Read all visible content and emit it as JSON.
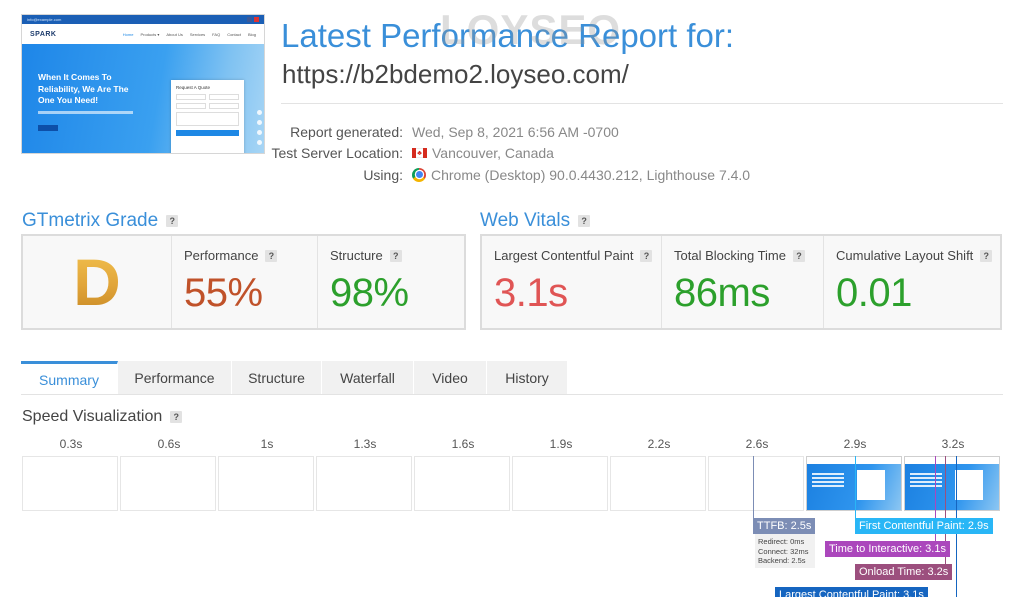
{
  "thumbnail": {
    "email": "info@example.com",
    "logo": "SPARK",
    "menu": [
      "Home",
      "Products ▾",
      "About Us",
      "Services",
      "FAQ",
      "Contact",
      "Blog"
    ],
    "hero_title": "When It Comes To Reliability, We Are The One You Need!",
    "form_title": "Request A Quote"
  },
  "header": {
    "watermark": "LOYSEO",
    "title": "Latest Performance Report for:",
    "url": "https://b2bdemo2.loyseo.com/"
  },
  "meta": {
    "generated_label": "Report generated:",
    "generated_value": "Wed, Sep 8, 2021 6:56 AM -0700",
    "location_label": "Test Server Location:",
    "location_value": "Vancouver, Canada",
    "using_label": "Using:",
    "using_value": "Chrome (Desktop) 90.0.4430.212, Lighthouse 7.4.0",
    "flag_icon": "canada-flag-icon",
    "browser_icon": "chrome-icon"
  },
  "gtmetrix": {
    "title": "GTmetrix Grade",
    "grade": "D",
    "performance_label": "Performance",
    "performance_value": "55%",
    "structure_label": "Structure",
    "structure_value": "98%"
  },
  "web_vitals": {
    "title": "Web Vitals",
    "lcp_label": "Largest Contentful Paint",
    "lcp_value": "3.1s",
    "tbt_label": "Total Blocking Time",
    "tbt_value": "86ms",
    "cls_label": "Cumulative Layout Shift",
    "cls_value": "0.01"
  },
  "help": "?",
  "tabs": [
    "Summary",
    "Performance",
    "Structure",
    "Waterfall",
    "Video",
    "History"
  ],
  "active_tab": "Summary",
  "speed_viz": {
    "title": "Speed Visualization",
    "times": [
      "0.3s",
      "0.6s",
      "1s",
      "1.3s",
      "1.6s",
      "1.9s",
      "2.2s",
      "2.6s",
      "2.9s",
      "3.2s"
    ],
    "markers": {
      "ttfb": "TTFB: 2.5s",
      "fcp": "First Contentful Paint: 2.9s",
      "tti": "Time to Interactive: 3.1s",
      "onload": "Onload Time: 3.2s",
      "lcp": "Largest Contentful Paint: 3.1s"
    },
    "ttfb_details": {
      "redirect": "Redirect: 0ms",
      "connect": "Connect: 32ms",
      "backend": "Backend: 2.5s"
    }
  },
  "colors": {
    "accent": "#3a8fd9",
    "grade_d": "#e0a43a",
    "performance": "#c0522a",
    "good": "#2ca02c",
    "lcp_value": "#e05555",
    "ttfb_marker": "#7c8db5",
    "fcp_marker": "#29b6f6",
    "tti_marker": "#ab47bc",
    "onload_marker": "#9c4f7e",
    "lcp_marker": "#1565c0"
  }
}
